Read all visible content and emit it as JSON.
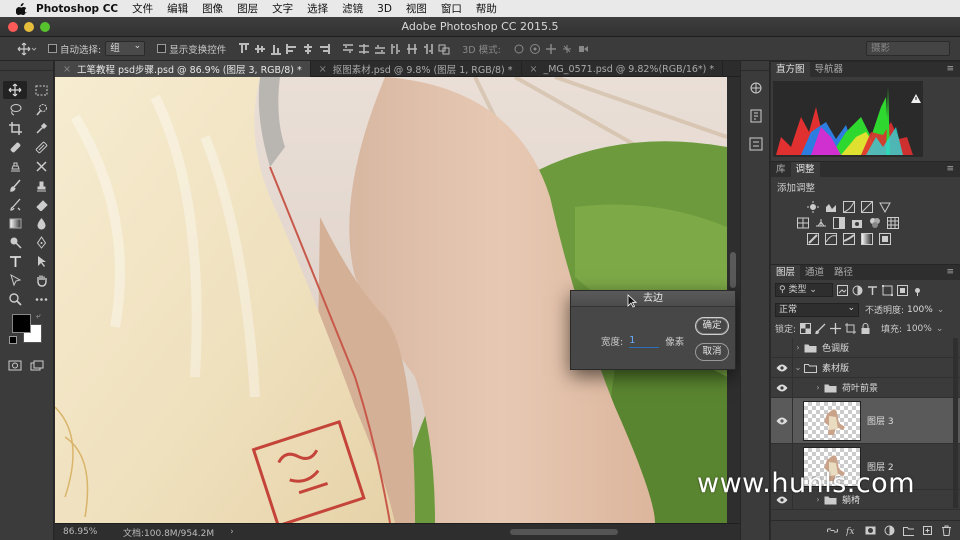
{
  "menubar": {
    "app_name": "Photoshop CC",
    "items": [
      "文件",
      "编辑",
      "图像",
      "图层",
      "文字",
      "选择",
      "滤镜",
      "3D",
      "视图",
      "窗口",
      "帮助"
    ]
  },
  "window": {
    "title": "Adobe Photoshop CC 2015.5"
  },
  "options": {
    "auto_select_label": "自动选择:",
    "auto_select_value": "组",
    "show_transform_label": "显示变换控件",
    "mode_3d_label": "3D 模式:",
    "workspace_value": "摄影"
  },
  "tabs": [
    {
      "label": "工笔教程 psd步骤.psd @ 86.9% (图层 3, RGB/8) *",
      "active": true
    },
    {
      "label": "抠图素材.psd @ 9.8% (图层 1, RGB/8) *",
      "active": false
    },
    {
      "label": "_MG_0571.psd @ 9.82%(RGB/16*) *",
      "active": false
    }
  ],
  "status": {
    "zoom": "86.95%",
    "doc_info": "文档:100.8M/954.2M",
    "arrow": "›"
  },
  "dialog": {
    "title": "去边",
    "width_label": "宽度:",
    "width_value": "1",
    "unit": "像素",
    "ok_label": "确定",
    "cancel_label": "取消"
  },
  "panels": {
    "histogram_tabs": [
      "直方图",
      "导航器"
    ],
    "adjust_tabs": [
      "库",
      "调整"
    ],
    "adjust_title": "添加调整",
    "layer_tabs": [
      "图层",
      "通道",
      "路径"
    ],
    "kind_label": "类型",
    "blend_mode": "正常",
    "opacity_label": "不透明度:",
    "opacity_value": "100%",
    "lock_label": "锁定:",
    "fill_label": "填充:",
    "fill_value": "100%"
  },
  "layers": [
    {
      "name": "色调版",
      "type": "group",
      "visible": false
    },
    {
      "name": "素材版",
      "type": "group",
      "visible": true,
      "open": true
    },
    {
      "name": "荷叶前景",
      "type": "group",
      "visible": true
    },
    {
      "name": "图层 3",
      "type": "layer",
      "visible": true,
      "selected": true
    },
    {
      "name": "图层 2",
      "type": "layer",
      "visible": false
    },
    {
      "name": "躺椅",
      "type": "group",
      "visible": true
    }
  ],
  "watermark": "www.hunls.com",
  "colors": {
    "accent": "#2c6fb5",
    "panel": "#3b3b3b",
    "selected_layer": "#5a5a5a"
  }
}
